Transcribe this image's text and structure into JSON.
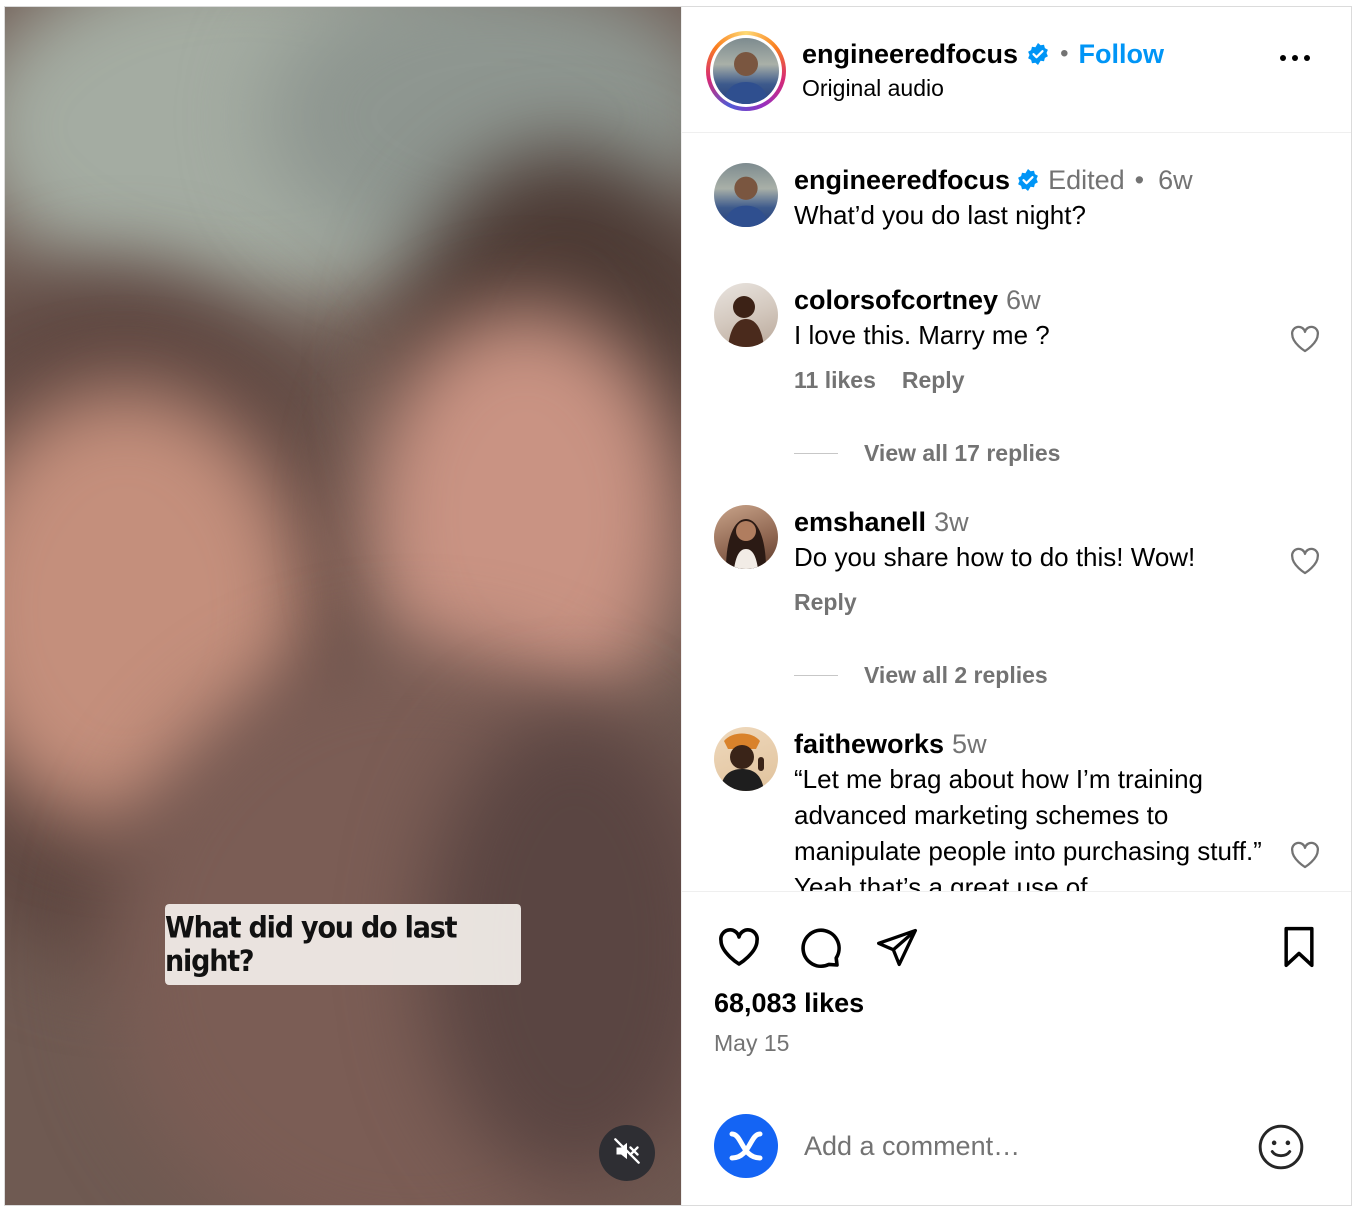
{
  "post": {
    "author": "engineeredfocus",
    "follow_label": "Follow",
    "separator": "•",
    "audio": "Original audio",
    "video_caption": "What did you do last night?"
  },
  "caption_comment": {
    "username": "engineeredfocus",
    "edited": "Edited",
    "separator": "•",
    "time": "6w",
    "text": "What’d you do last night?"
  },
  "comments": [
    {
      "username": "colorsofcortney",
      "time": "6w",
      "text": "I love this. Marry me ?",
      "likes": "11 likes",
      "reply_label": "Reply",
      "view_replies": "View all 17 replies"
    },
    {
      "username": "emshanell",
      "time": "3w",
      "text": "Do you share how to do this! Wow!",
      "reply_label": "Reply",
      "view_replies": "View all 2 replies"
    },
    {
      "username": "faitheworks",
      "time": "5w",
      "text": "“Let me brag about how I’m training advanced marketing schemes to manipulate people into purchasing stuff.” Yeah that’s a great use of"
    }
  ],
  "stats": {
    "likes": "68,083 likes",
    "date": "May 15"
  },
  "add_comment": {
    "placeholder": "Add a comment…"
  },
  "icons": [
    "verified-badge-icon",
    "more-options-icon",
    "heart-icon",
    "comment-icon",
    "share-icon",
    "bookmark-icon",
    "emoji-icon",
    "mute-icon"
  ],
  "colors": {
    "link_blue": "#0095f6",
    "verified_blue": "#0095f6",
    "secondary_text": "#737373",
    "profile_blue": "#1464f4"
  }
}
